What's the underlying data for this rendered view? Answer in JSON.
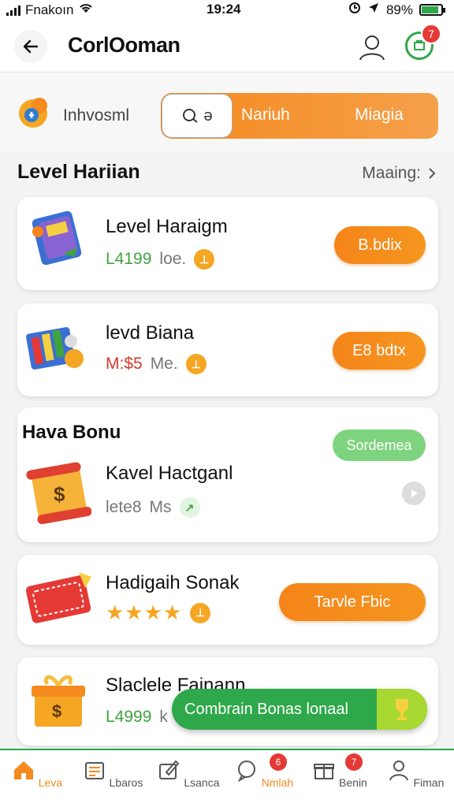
{
  "status_bar": {
    "carrier": "Fnakoın",
    "time": "19:24",
    "battery": "89%",
    "battery_level": 0.89
  },
  "header": {
    "title": "CorlOoman",
    "cart_badge": "7"
  },
  "tab_row": {
    "brand": "Inhvosml",
    "search_glyph": "ə",
    "tabs": [
      "Nariuh",
      "Miagia"
    ]
  },
  "section": {
    "title": "Level Hariian",
    "more": "Maaing:"
  },
  "cards": [
    {
      "title": "Level Haraigm",
      "num": "L4199",
      "unit": "loe.",
      "num_color": "#3fa33f",
      "button": "B.bdix"
    },
    {
      "title": "levd Biana",
      "num": "M:$5",
      "unit": "Me.",
      "num_color": "#d03a2a",
      "button": "E8 bdtx"
    }
  ],
  "bonus_card": {
    "header": "Hava Bonu",
    "title": "Kavel Hactganl",
    "num": "lete8",
    "unit": "Ms",
    "tag": "Sordemea"
  },
  "gift_card": {
    "title": "Hadigaih Sonak",
    "stars": "★★★★",
    "button": "Tarvle Fbic"
  },
  "box_card": {
    "title": "Slaclele Fainann",
    "num": "L4999",
    "unit": "k"
  },
  "toast": {
    "text": "Combrain Bonas lonaal"
  },
  "bottom_nav": [
    {
      "label": "Leva",
      "icon": "home-icon",
      "active": true
    },
    {
      "label": "Lbaros",
      "icon": "document-icon"
    },
    {
      "label": "Lsanca",
      "icon": "edit-icon"
    },
    {
      "label": "Nmlah",
      "icon": "chat-icon",
      "badge": "6"
    },
    {
      "label": "Benin",
      "icon": "gift-icon",
      "badge": "7"
    },
    {
      "label": "Fiman",
      "icon": "profile-icon"
    }
  ],
  "colors": {
    "accent": "#f58a1f",
    "green": "#2ea84a",
    "badge": "#e53935"
  }
}
